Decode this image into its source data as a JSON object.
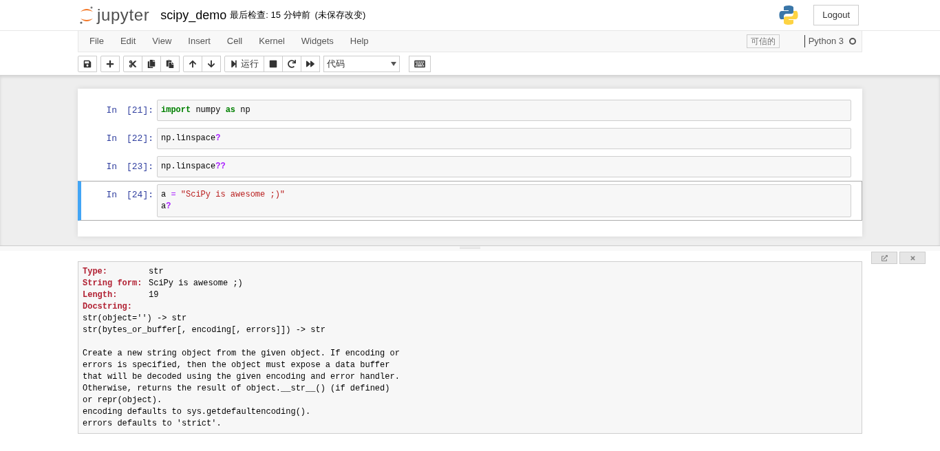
{
  "header": {
    "logo_text": "jupyter",
    "notebook_name": "scipy_demo",
    "checkpoint": "最后检查: 15 分钟前",
    "autosave": "(未保存改变)",
    "logout": "Logout"
  },
  "menu": [
    "File",
    "Edit",
    "View",
    "Insert",
    "Cell",
    "Kernel",
    "Widgets",
    "Help"
  ],
  "trusted": "可信的",
  "kernel": {
    "name": "Python 3",
    "busy": false
  },
  "toolbar": [
    {
      "kind": "save"
    },
    {
      "kind": "gap"
    },
    {
      "kind": "add"
    },
    {
      "kind": "gap"
    },
    {
      "kind": "cut"
    },
    {
      "kind": "copy"
    },
    {
      "kind": "paste"
    },
    {
      "kind": "gap"
    },
    {
      "kind": "up"
    },
    {
      "kind": "down"
    },
    {
      "kind": "gap"
    },
    {
      "kind": "run",
      "label": "运行"
    },
    {
      "kind": "stop"
    },
    {
      "kind": "restart"
    },
    {
      "kind": "forward"
    }
  ],
  "cell_type": "代码",
  "cells": [
    {
      "prompt": "In",
      "count": "[21]:",
      "selected": false,
      "lines": [
        [
          {
            "kind": "keyword",
            "text": "import"
          },
          {
            "kind": "plain",
            "text": " numpy "
          },
          {
            "kind": "keyword",
            "text": "as"
          },
          {
            "kind": "plain",
            "text": " np"
          }
        ]
      ]
    },
    {
      "prompt": "In",
      "count": "[22]:",
      "selected": false,
      "lines": [
        [
          {
            "kind": "plain",
            "text": "np.linspace"
          },
          {
            "kind": "help",
            "text": "?"
          }
        ]
      ]
    },
    {
      "prompt": "In",
      "count": "[23]:",
      "selected": false,
      "lines": [
        [
          {
            "kind": "plain",
            "text": "np.linspace"
          },
          {
            "kind": "help",
            "text": "??"
          }
        ]
      ]
    },
    {
      "prompt": "In",
      "count": "[24]:",
      "selected": true,
      "lines": [
        [
          {
            "kind": "plain",
            "text": "a "
          },
          {
            "kind": "operator",
            "text": "= "
          },
          {
            "kind": "string",
            "text": "\"SciPy is awesome ;)\""
          }
        ],
        [
          {
            "kind": "plain",
            "text": "a"
          },
          {
            "kind": "help",
            "text": "?"
          }
        ]
      ]
    }
  ],
  "pager": {
    "fields": [
      {
        "label": "Type:",
        "value": "str"
      },
      {
        "label": "String form:",
        "value": "SciPy is awesome ;)"
      },
      {
        "label": "Length:",
        "value": "19"
      },
      {
        "label": "Docstring:"
      }
    ],
    "docstring": [
      [
        "str(object='') -> str",
        "str(bytes_or_buffer[, encoding[, errors]]) -> str"
      ],
      [
        "Create a new string object from the given object. If encoding or",
        "errors is specified, then the object must expose a data buffer",
        "that will be decoded using the given encoding and error handler.",
        "Otherwise, returns the result of object.__str__() (if defined)",
        "or repr(object).",
        "encoding defaults to sys.getdefaultencoding().",
        "errors defaults to 'strict'."
      ]
    ]
  }
}
